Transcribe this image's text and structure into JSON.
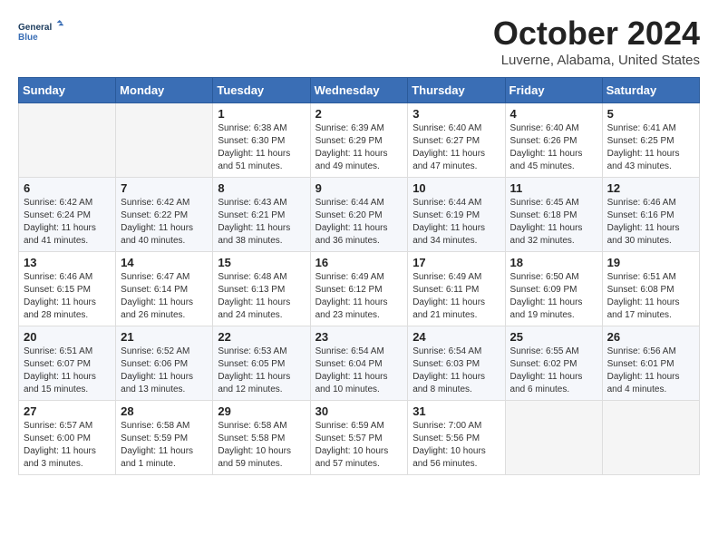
{
  "header": {
    "logo_line1": "General",
    "logo_line2": "Blue",
    "month_title": "October 2024",
    "location": "Luverne, Alabama, United States"
  },
  "days_of_week": [
    "Sunday",
    "Monday",
    "Tuesday",
    "Wednesday",
    "Thursday",
    "Friday",
    "Saturday"
  ],
  "weeks": [
    [
      {
        "day": "",
        "info": ""
      },
      {
        "day": "",
        "info": ""
      },
      {
        "day": "1",
        "info": "Sunrise: 6:38 AM\nSunset: 6:30 PM\nDaylight: 11 hours and 51 minutes."
      },
      {
        "day": "2",
        "info": "Sunrise: 6:39 AM\nSunset: 6:29 PM\nDaylight: 11 hours and 49 minutes."
      },
      {
        "day": "3",
        "info": "Sunrise: 6:40 AM\nSunset: 6:27 PM\nDaylight: 11 hours and 47 minutes."
      },
      {
        "day": "4",
        "info": "Sunrise: 6:40 AM\nSunset: 6:26 PM\nDaylight: 11 hours and 45 minutes."
      },
      {
        "day": "5",
        "info": "Sunrise: 6:41 AM\nSunset: 6:25 PM\nDaylight: 11 hours and 43 minutes."
      }
    ],
    [
      {
        "day": "6",
        "info": "Sunrise: 6:42 AM\nSunset: 6:24 PM\nDaylight: 11 hours and 41 minutes."
      },
      {
        "day": "7",
        "info": "Sunrise: 6:42 AM\nSunset: 6:22 PM\nDaylight: 11 hours and 40 minutes."
      },
      {
        "day": "8",
        "info": "Sunrise: 6:43 AM\nSunset: 6:21 PM\nDaylight: 11 hours and 38 minutes."
      },
      {
        "day": "9",
        "info": "Sunrise: 6:44 AM\nSunset: 6:20 PM\nDaylight: 11 hours and 36 minutes."
      },
      {
        "day": "10",
        "info": "Sunrise: 6:44 AM\nSunset: 6:19 PM\nDaylight: 11 hours and 34 minutes."
      },
      {
        "day": "11",
        "info": "Sunrise: 6:45 AM\nSunset: 6:18 PM\nDaylight: 11 hours and 32 minutes."
      },
      {
        "day": "12",
        "info": "Sunrise: 6:46 AM\nSunset: 6:16 PM\nDaylight: 11 hours and 30 minutes."
      }
    ],
    [
      {
        "day": "13",
        "info": "Sunrise: 6:46 AM\nSunset: 6:15 PM\nDaylight: 11 hours and 28 minutes."
      },
      {
        "day": "14",
        "info": "Sunrise: 6:47 AM\nSunset: 6:14 PM\nDaylight: 11 hours and 26 minutes."
      },
      {
        "day": "15",
        "info": "Sunrise: 6:48 AM\nSunset: 6:13 PM\nDaylight: 11 hours and 24 minutes."
      },
      {
        "day": "16",
        "info": "Sunrise: 6:49 AM\nSunset: 6:12 PM\nDaylight: 11 hours and 23 minutes."
      },
      {
        "day": "17",
        "info": "Sunrise: 6:49 AM\nSunset: 6:11 PM\nDaylight: 11 hours and 21 minutes."
      },
      {
        "day": "18",
        "info": "Sunrise: 6:50 AM\nSunset: 6:09 PM\nDaylight: 11 hours and 19 minutes."
      },
      {
        "day": "19",
        "info": "Sunrise: 6:51 AM\nSunset: 6:08 PM\nDaylight: 11 hours and 17 minutes."
      }
    ],
    [
      {
        "day": "20",
        "info": "Sunrise: 6:51 AM\nSunset: 6:07 PM\nDaylight: 11 hours and 15 minutes."
      },
      {
        "day": "21",
        "info": "Sunrise: 6:52 AM\nSunset: 6:06 PM\nDaylight: 11 hours and 13 minutes."
      },
      {
        "day": "22",
        "info": "Sunrise: 6:53 AM\nSunset: 6:05 PM\nDaylight: 11 hours and 12 minutes."
      },
      {
        "day": "23",
        "info": "Sunrise: 6:54 AM\nSunset: 6:04 PM\nDaylight: 11 hours and 10 minutes."
      },
      {
        "day": "24",
        "info": "Sunrise: 6:54 AM\nSunset: 6:03 PM\nDaylight: 11 hours and 8 minutes."
      },
      {
        "day": "25",
        "info": "Sunrise: 6:55 AM\nSunset: 6:02 PM\nDaylight: 11 hours and 6 minutes."
      },
      {
        "day": "26",
        "info": "Sunrise: 6:56 AM\nSunset: 6:01 PM\nDaylight: 11 hours and 4 minutes."
      }
    ],
    [
      {
        "day": "27",
        "info": "Sunrise: 6:57 AM\nSunset: 6:00 PM\nDaylight: 11 hours and 3 minutes."
      },
      {
        "day": "28",
        "info": "Sunrise: 6:58 AM\nSunset: 5:59 PM\nDaylight: 11 hours and 1 minute."
      },
      {
        "day": "29",
        "info": "Sunrise: 6:58 AM\nSunset: 5:58 PM\nDaylight: 10 hours and 59 minutes."
      },
      {
        "day": "30",
        "info": "Sunrise: 6:59 AM\nSunset: 5:57 PM\nDaylight: 10 hours and 57 minutes."
      },
      {
        "day": "31",
        "info": "Sunrise: 7:00 AM\nSunset: 5:56 PM\nDaylight: 10 hours and 56 minutes."
      },
      {
        "day": "",
        "info": ""
      },
      {
        "day": "",
        "info": ""
      }
    ]
  ]
}
